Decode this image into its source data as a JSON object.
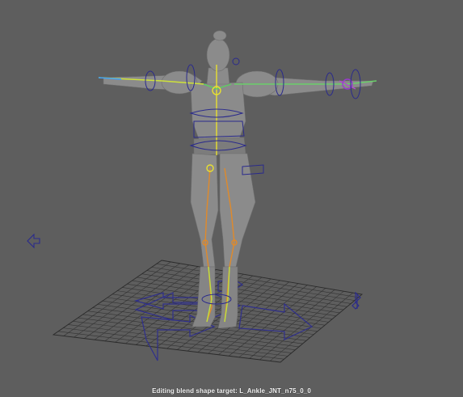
{
  "app": "3D viewport",
  "viewport": {
    "status_message": "Editing blend shape target: L_Ankle_JNT_n75_0_0"
  },
  "colors": {
    "background": "#5e5e5e",
    "grid_lines": "#2e2e2e",
    "mesh_fill": "#8a8a8a",
    "controller_blue": "#2a2a8a",
    "joint_orange": "#e08a2a",
    "joint_yellow": "#e8e030",
    "joint_green": "#60e060"
  },
  "icons": [
    "move-arrow-icon-left",
    "move-arrow-icon-right",
    "global-move-controller-icon"
  ]
}
